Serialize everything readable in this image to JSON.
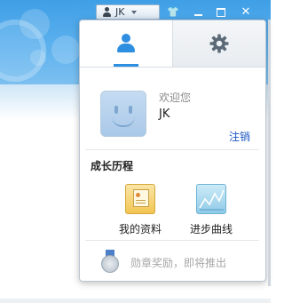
{
  "titlebar": {
    "user_label": "JK"
  },
  "panel": {
    "tabs": [
      {
        "name": "profile",
        "icon": "person-icon",
        "active": true
      },
      {
        "name": "settings",
        "icon": "gear-icon",
        "active": false
      }
    ],
    "welcome": "欢迎您",
    "username": "JK",
    "logout": "注销",
    "section_title": "成长历程",
    "items": [
      {
        "label": "我的资料",
        "icon": "profile-card-icon"
      },
      {
        "label": "进步曲线",
        "icon": "progress-curve-icon"
      }
    ],
    "medal_text": "勋章奖励，即将推出"
  },
  "colors": {
    "accent": "#2e8fe0",
    "link": "#1a55c4",
    "header_blue": "#3f9fe6"
  }
}
